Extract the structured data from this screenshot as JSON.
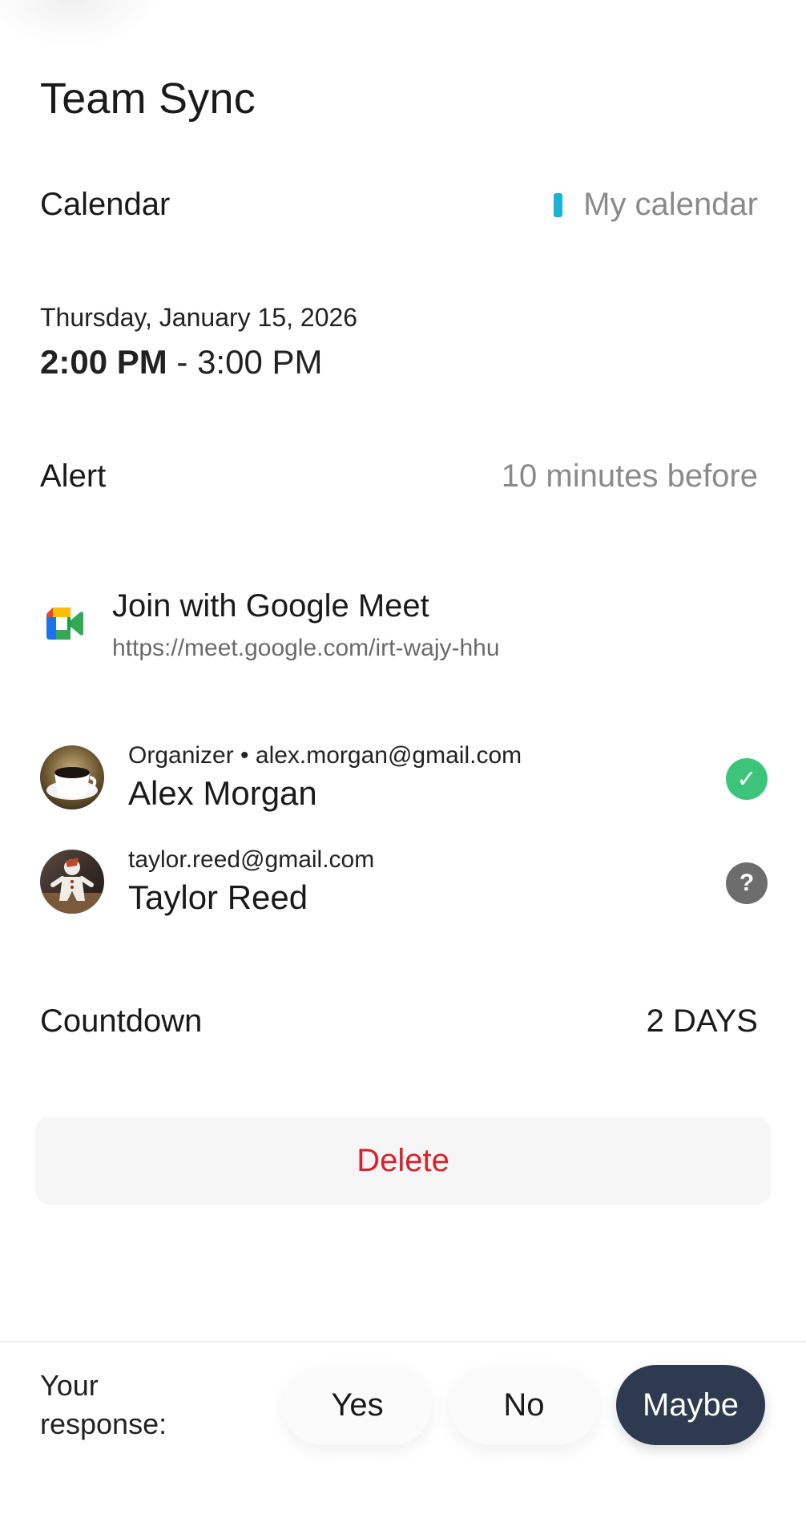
{
  "event": {
    "title": "Team Sync",
    "calendar_label": "Calendar",
    "calendar_value": "My calendar",
    "calendar_color": "#1ab3d3",
    "date": "Thursday, January 15, 2026",
    "time_start": "2:00 PM",
    "time_separator": " - ",
    "time_end": "3:00 PM",
    "alert_label": "Alert",
    "alert_value": "10 minutes before"
  },
  "meet": {
    "icon": "google-meet-icon",
    "title": "Join with Google Meet",
    "url": "https://meet.google.com/irt-wajy-hhu"
  },
  "attendees": [
    {
      "sub": "Organizer • alex.morgan@gmail.com",
      "name": "Alex Morgan",
      "status": "accepted",
      "status_icon": "check-icon",
      "status_glyph": "✓",
      "avatar": "coffee-cup-avatar"
    },
    {
      "sub": "taylor.reed@gmail.com",
      "name": "Taylor Reed",
      "status": "no-response",
      "status_icon": "question-icon",
      "status_glyph": "?",
      "avatar": "gingerbread-avatar"
    }
  ],
  "countdown": {
    "label": "Countdown",
    "value": "2 DAYS"
  },
  "actions": {
    "delete_label": "Delete",
    "delete_color": "#d4242a"
  },
  "response": {
    "label": "Your response:",
    "options": [
      "Yes",
      "No",
      "Maybe"
    ],
    "selected": "Maybe",
    "accent": "#2d3a4f"
  }
}
